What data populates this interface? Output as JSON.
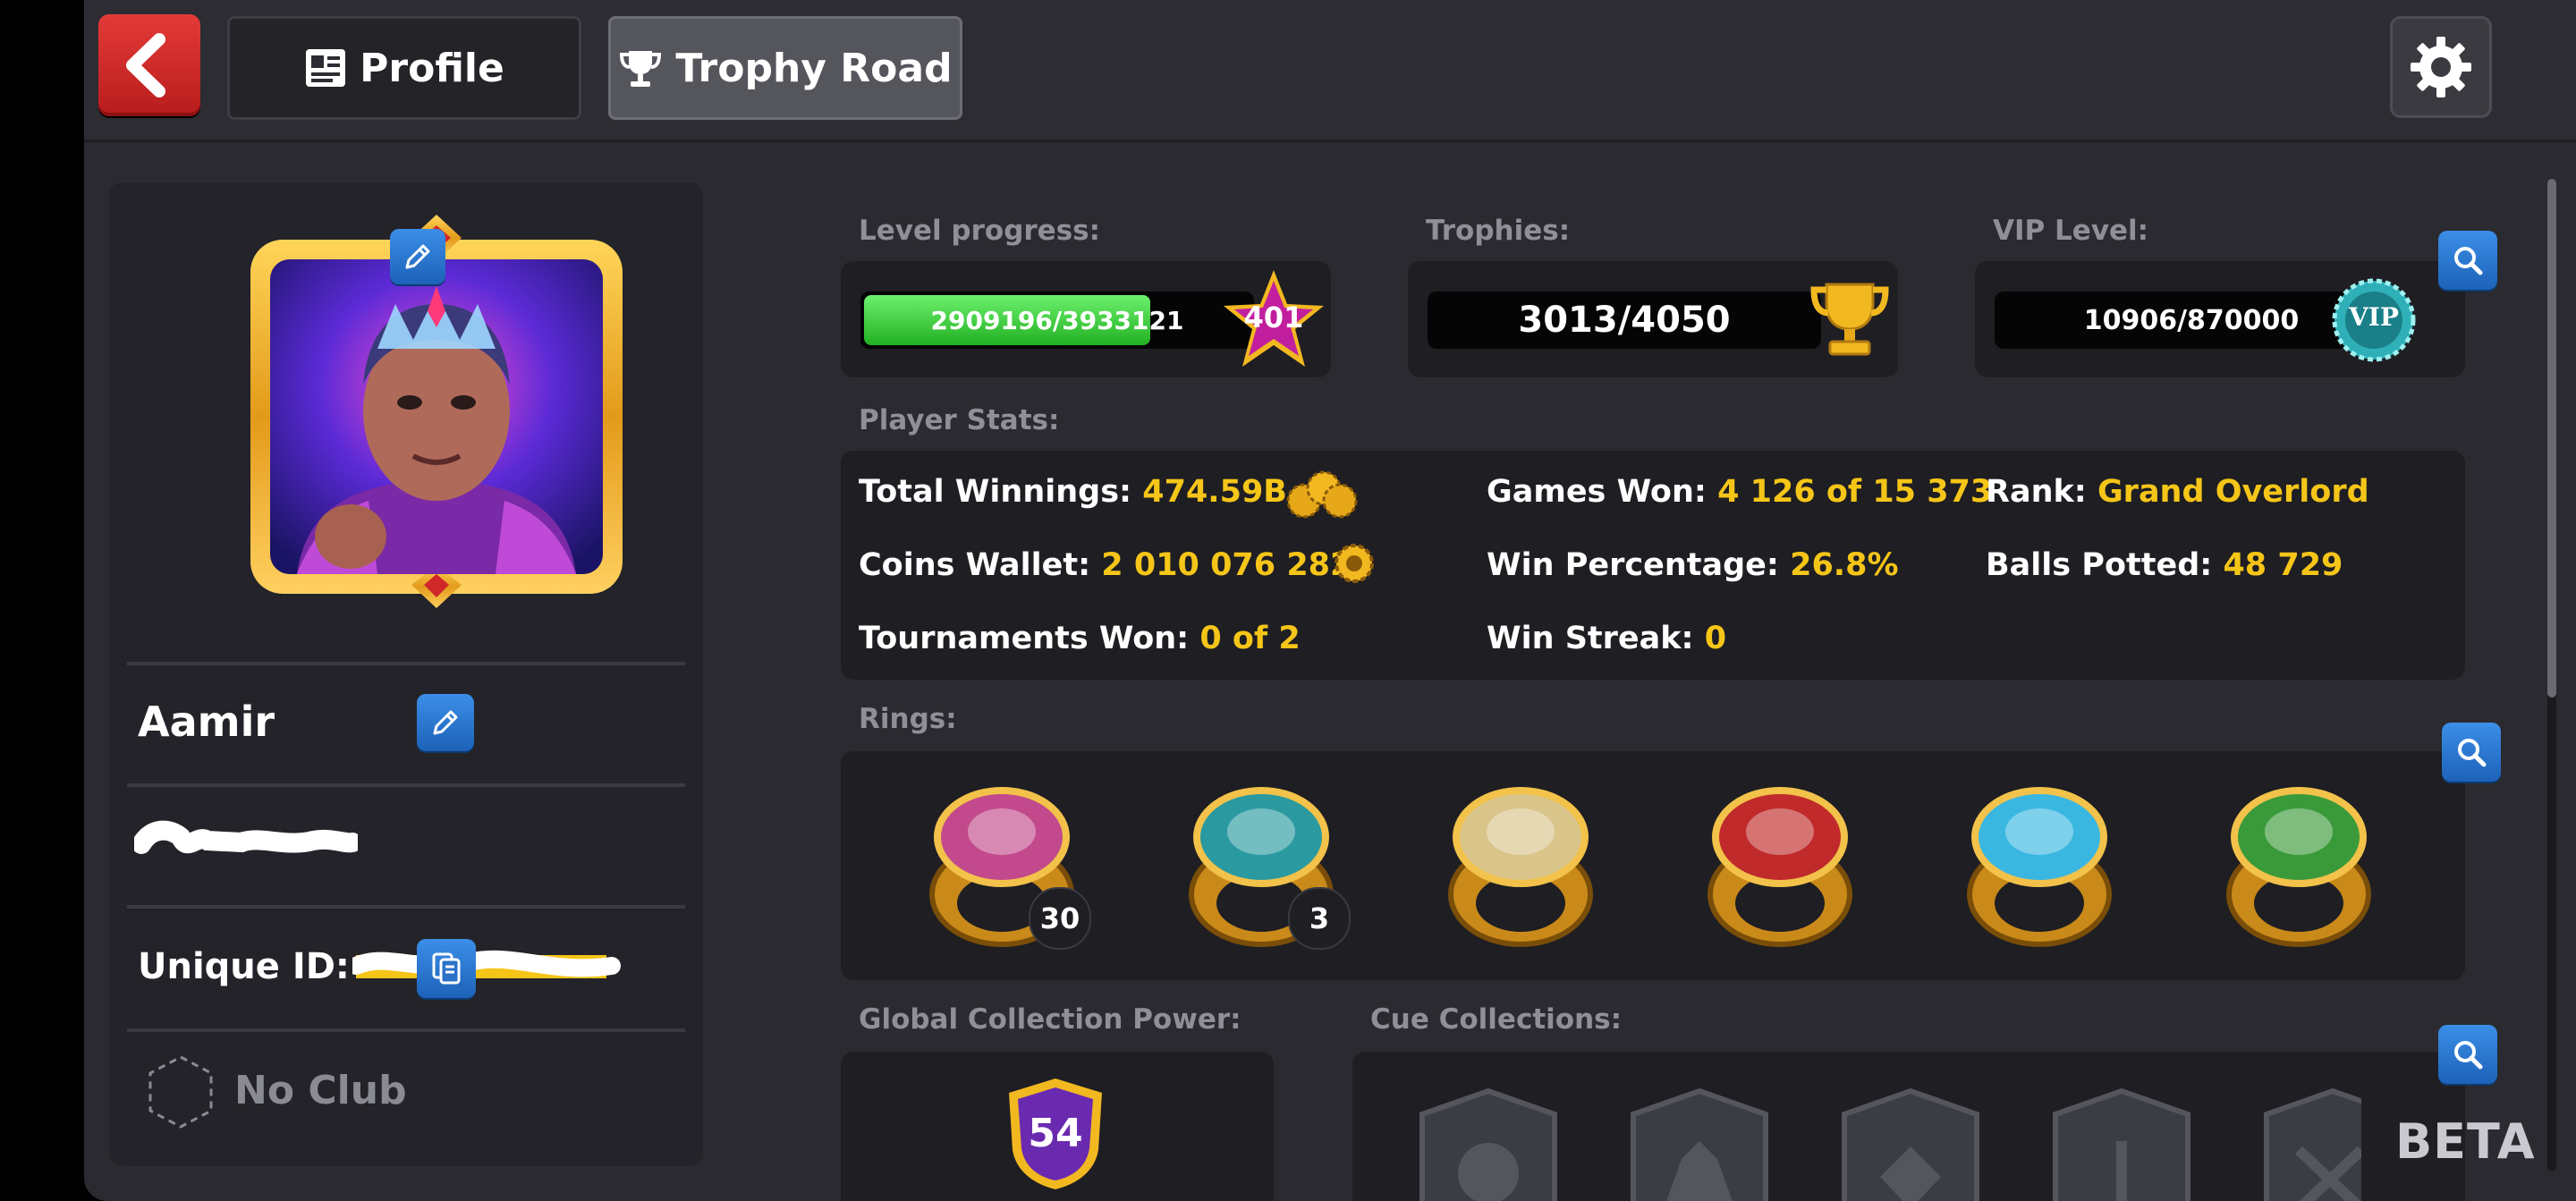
{
  "header": {
    "profile_tab": "Profile",
    "trophy_tab": "Trophy Road"
  },
  "profile": {
    "name": "Aamir",
    "unique_id_label": "Unique ID:",
    "no_club": "No Club"
  },
  "level": {
    "label": "Level progress:",
    "progress_text": "2909196/3933121",
    "progress_fraction": 0.74,
    "level": "401"
  },
  "trophies": {
    "label": "Trophies:",
    "value": "3013/4050"
  },
  "vip": {
    "label": "VIP Level:",
    "value": "10906/870000",
    "badge": "VIP"
  },
  "stats": {
    "label": "Player Stats:",
    "total_winnings_label": "Total Winnings:",
    "total_winnings": "474.59B",
    "coins_wallet_label": "Coins Wallet:",
    "coins_wallet": "2 010 076 282",
    "tournaments_won_label": "Tournaments Won:",
    "tournaments_won": "0 of 2",
    "games_won_label": "Games Won:",
    "games_won": "4 126 of 15 373",
    "win_percentage_label": "Win Percentage:",
    "win_percentage": "26.8%",
    "win_streak_label": "Win Streak:",
    "win_streak": "0",
    "rank_label": "Rank:",
    "rank": "Grand Overlord",
    "balls_potted_label": "Balls Potted:",
    "balls_potted": "48 729"
  },
  "rings": {
    "label": "Rings:",
    "items": [
      {
        "name": "legend-ring",
        "count": "30",
        "color": "#c24a8c"
      },
      {
        "name": "berlin-legend-ring",
        "count": "3",
        "color": "#2a9aa0"
      },
      {
        "name": "diamond-ring",
        "count": "",
        "color": "#d9c48a"
      },
      {
        "name": "emerald-ring",
        "count": "",
        "color": "#c02a2a"
      },
      {
        "name": "topaz-ring",
        "count": "",
        "color": "#3ab7e0"
      },
      {
        "name": "dragon-ring",
        "count": "",
        "color": "#3a9a3a"
      }
    ]
  },
  "collection": {
    "global_label": "Global Collection Power:",
    "power": "54",
    "cue_label": "Cue Collections:"
  },
  "footer": {
    "beta": "BETA"
  },
  "colors": {
    "accent_yellow": "#f5c518",
    "progress_green": "#3fd43f",
    "button_blue": "#2f7fd8",
    "back_red": "#d42f2f"
  }
}
